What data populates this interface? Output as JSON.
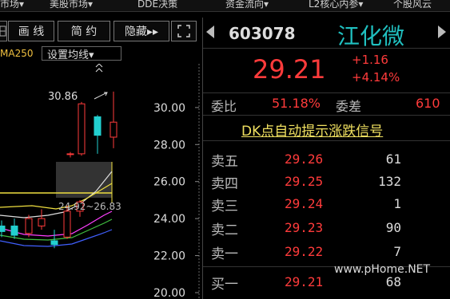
{
  "topbar": {
    "tabs": [
      "市场▾",
      "美股市场▾",
      "DDE决策",
      "资金流向▾",
      "L2核心内参▾",
      "个股风云"
    ]
  },
  "toolbar": {
    "grid_icon": "grid-icon",
    "draw_label": "画 线",
    "simple_label": "简 约",
    "hide_label": "隐藏▸▸",
    "fullscreen_icon": "fullscreen-icon"
  },
  "ma": {
    "label": "MA250",
    "setting_label": "设置均线▾"
  },
  "chart_data": {
    "type": "candlestick",
    "yticks": [
      "30.00",
      "28.00",
      "26.00",
      "24.00",
      "22.00",
      "20.00"
    ],
    "ylim": [
      20,
      31.2
    ],
    "high_label": "30.86",
    "range_label": "24.92~26.83",
    "candles": [
      {
        "o": 23.3,
        "h": 23.9,
        "l": 23.0,
        "c": 23.6,
        "up": false
      },
      {
        "o": 23.6,
        "h": 24.0,
        "l": 22.9,
        "c": 23.1,
        "up": false
      },
      {
        "o": 23.2,
        "h": 24.2,
        "l": 23.0,
        "c": 24.0,
        "up": true
      },
      {
        "o": 24.0,
        "h": 24.5,
        "l": 23.4,
        "c": 23.6,
        "up": true
      },
      {
        "o": 22.8,
        "h": 23.4,
        "l": 22.4,
        "c": 22.6,
        "up": false
      },
      {
        "o": 23.0,
        "h": 24.7,
        "l": 22.9,
        "c": 24.4,
        "up": true
      },
      {
        "o": 24.4,
        "h": 25.0,
        "l": 24.1,
        "c": 24.9,
        "up": true
      },
      {
        "o": 27.5,
        "h": 27.6,
        "l": 27.3,
        "c": 27.5,
        "up": true
      },
      {
        "o": 27.5,
        "h": 30.3,
        "l": 27.4,
        "c": 30.2,
        "up": true
      },
      {
        "o": 28.5,
        "h": 29.6,
        "l": 27.5,
        "c": 29.5,
        "up": false
      },
      {
        "o": 28.4,
        "h": 30.86,
        "l": 27.8,
        "c": 29.21,
        "up": true
      }
    ]
  },
  "quote": {
    "symbol": "603078",
    "name": "江化微",
    "price": "29.21",
    "change": "+1.16",
    "change_pct": "+4.14%",
    "wb_label": "委比",
    "wb_value": "51.18%",
    "wc_label": "委差",
    "wc_value": "610",
    "dk_text": "DK点自动提示涨跌信号"
  },
  "orderbook": [
    {
      "label": "卖五",
      "price": "29.26",
      "vol": "61"
    },
    {
      "label": "卖四",
      "price": "29.25",
      "vol": "132"
    },
    {
      "label": "卖三",
      "price": "29.24",
      "vol": "1"
    },
    {
      "label": "卖二",
      "price": "29.23",
      "vol": "90"
    },
    {
      "label": "卖一",
      "price": "29.22",
      "vol": "7"
    },
    {
      "label": "买一",
      "price": "29.21",
      "vol": "68"
    }
  ],
  "colors": {
    "up": "#ff3b3b",
    "down": "#22d0d0",
    "accent": "#20c0c0"
  },
  "watermark": "www.pHome.NET"
}
